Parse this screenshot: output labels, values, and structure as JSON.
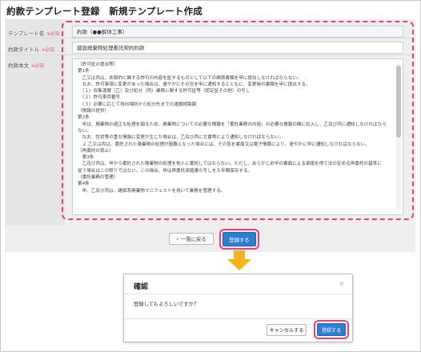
{
  "page": {
    "title": "約款テンプレート登録　新規テンプレート作成"
  },
  "form": {
    "rows": [
      {
        "label": "テンプレート名",
        "required": "※必須"
      },
      {
        "label": "約款タイトル",
        "required": "※必須"
      },
      {
        "label": "約款本文",
        "required": "※必須"
      }
    ],
    "template_name_value": "約款（●●解体工事）",
    "contract_title_value": "建設廃棄物処理委託契約約款",
    "body_lines": [
      "（許可証の提出等）",
      "第1条",
      "　乙又は丙は、本契約に関する許可の内容を証するものとして以下の関係書類を甲に提出しなければならない。",
      "　なお、許可事項に変更があった場合は、速やかにその旨を甲に通知するとともに、変更後の書類を甲に提出する。",
      "　（１）収集運搬（乙）及び処分（丙）業務に関する許可証等（認定証その他）の写し",
      "　（２）許可車両番号",
      "　（３）必要に応じて排出場所から処分先までの運搬経路図",
      "（情報の提供）",
      "第2条",
      "　甲は、廃棄物の適正な処理を図るため、廃棄物についての必要な情報を「委託業務の内容」の必要な情報の欄に記入し、乙及び丙に通知しなければなら",
      "ない。",
      "　なお、性状等の重な情報に変更が生じた場合は、乙及び丙に文書等により通知しなければならない。",
      "　２.乙又は丙は、委託された廃棄物の処理が困難となった場合には、その旨を書面又は電子情報により、速やかに甲に通知しなければならない。",
      "（再委託の禁止）",
      "　第3条",
      "　乙及び丙は、甲から委託された廃棄物の処理を他人に委託してはならない。ただし、あらかじめ甲の書面による承諾を得て法の定める再委託の基準に",
      "従う場合はこの限りではない。この場合、甲は再委託承諾書の写しを５年間保存する。",
      "（委託業務の管理）",
      "第4条",
      "　甲、乙及び丙は、建設系廃棄物マニフェストを用いて業務を管理する。"
    ]
  },
  "buttons": {
    "back_label": "一覧に戻る",
    "back_icon": "chevron-left-icon",
    "register_label": "登録する"
  },
  "dialog": {
    "title": "確認",
    "close_glyph": "×",
    "message": "登録してもよろしいですか？",
    "cancel_label": "キャンセルする",
    "register_label": "登録する"
  },
  "colors": {
    "highlight": "#e8407a",
    "primary_button": "#2f7fd1",
    "arrow": "#f5b321"
  }
}
